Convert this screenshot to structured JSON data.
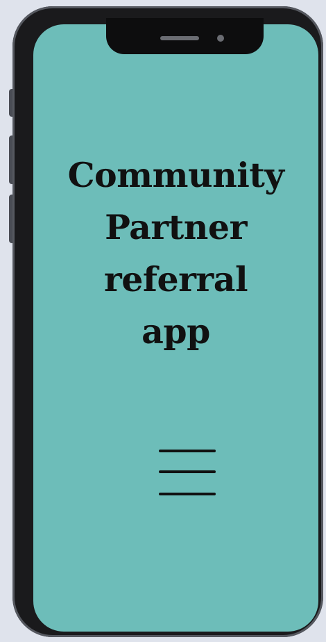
{
  "app": {
    "title_lines": [
      "Community",
      "Partner",
      "referral",
      "app"
    ]
  },
  "menu": {
    "icon": "hamburger-menu-icon"
  },
  "colors": {
    "screen_background": "#6dbdb9",
    "phone_frame": "#1a1a1c",
    "page_background": "#dfe3ec",
    "text": "#111111"
  }
}
